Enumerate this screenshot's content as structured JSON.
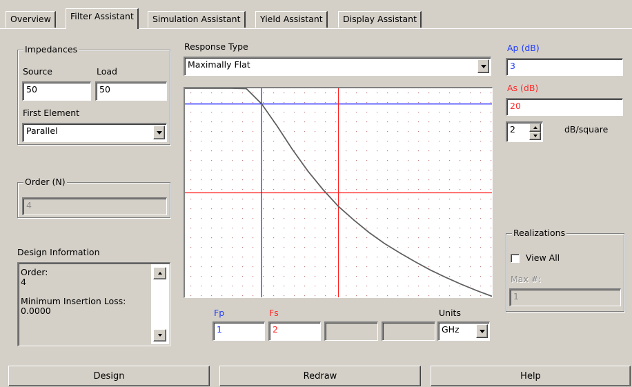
{
  "tabs": [
    {
      "label": "Overview",
      "active": false
    },
    {
      "label": "Filter Assistant",
      "active": true
    },
    {
      "label": "Simulation Assistant",
      "active": false
    },
    {
      "label": "Yield Assistant",
      "active": false
    },
    {
      "label": "Display Assistant",
      "active": false
    }
  ],
  "impedances": {
    "title": "Impedances",
    "source_label": "Source",
    "source_value": "50",
    "load_label": "Load",
    "load_value": "50",
    "first_element_label": "First Element",
    "first_element_value": "Parallel"
  },
  "order": {
    "title": "Order (N)",
    "value": "4"
  },
  "design_information": {
    "title": "Design Information",
    "lines": [
      "Order:",
      "4",
      "",
      "Minimum Insertion Loss:",
      "0.0000"
    ]
  },
  "response_type": {
    "label": "Response Type",
    "value": "Maximally Flat"
  },
  "right_panel": {
    "ap_label": "Ap (dB)",
    "ap_value": "3",
    "as_label": "As (dB)",
    "as_value": "20",
    "spin_value": "2",
    "dbsquare_label": "dB/square"
  },
  "realizations": {
    "title": "Realizations",
    "view_all_label": "View All",
    "view_all_checked": false,
    "max_label": "Max #:",
    "max_value": "1"
  },
  "freq": {
    "fp_label": "Fp",
    "fp_value": "1",
    "fs_label": "Fs",
    "fs_value": "2",
    "extra1_value": "",
    "extra2_value": "",
    "units_label": "Units",
    "units_value": "GHz"
  },
  "buttons": {
    "design": "Design",
    "redraw": "Redraw",
    "help": "Help"
  },
  "colors": {
    "passband_marker": "#2020ff",
    "stopband_marker": "#ff2020",
    "curve": "#606060",
    "grid_dots": "#c08080"
  },
  "chart_data": {
    "type": "line",
    "title": "",
    "xlabel": "",
    "ylabel": "",
    "grid": true,
    "xlim": [
      0,
      4
    ],
    "ylim_db": [
      0,
      40
    ],
    "fp": 1,
    "fs": 2,
    "ap_db": 3,
    "as_db": 20,
    "order": 4,
    "series": [
      {
        "x": [
          0,
          0.2,
          0.4,
          0.6,
          0.8,
          1.0,
          1.2,
          1.4,
          1.6,
          1.8,
          2.0,
          2.2,
          2.4,
          2.6,
          2.8,
          3.0,
          3.2,
          3.4,
          3.6,
          3.8,
          4.0
        ],
        "y": [
          0,
          0.0,
          0.0,
          0.0,
          0.06,
          3.0,
          7.2,
          11.7,
          15.8,
          19.4,
          22.6,
          25.2,
          27.6,
          29.7,
          31.5,
          33.2,
          34.8,
          36.2,
          37.5,
          38.7,
          39.8
        ]
      }
    ]
  }
}
